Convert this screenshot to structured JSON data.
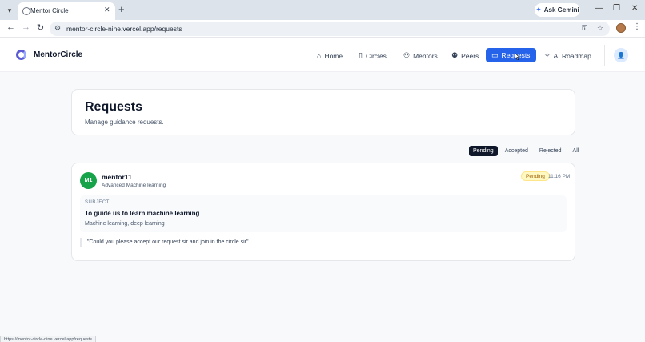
{
  "browser": {
    "tab_title": "Mentor Circle",
    "tab_close": "✕",
    "new_tab": "+",
    "ask_gemini": "Ask Gemini",
    "url": "mentor-circle-nine.vercel.app/requests",
    "status_url": "https://mentor-circle-nine.vercel.app/requests"
  },
  "header": {
    "brand": "MentorCircle",
    "nav": [
      {
        "label": "Home",
        "icon": "home-icon"
      },
      {
        "label": "Circles",
        "icon": "book-icon"
      },
      {
        "label": "Mentors",
        "icon": "user-check-icon"
      },
      {
        "label": "Peers",
        "icon": "users-icon"
      },
      {
        "label": "Requests",
        "icon": "message-icon",
        "active": true
      },
      {
        "label": "AI Roadmap",
        "icon": "sparkles-icon"
      }
    ]
  },
  "page": {
    "title": "Requests",
    "subtitle": "Manage guidance requests."
  },
  "filters": [
    "Pending",
    "Accepted",
    "Rejected",
    "All"
  ],
  "active_filter": "Pending",
  "requests": [
    {
      "avatar_initials": "M1",
      "name": "mentor11",
      "topic": "Advanced Machine learning",
      "status": "Pending",
      "time": "11:16 PM",
      "subject_label": "SUBJECT",
      "subject": "To guide us to learn machine learning",
      "tags": "Machine learning, deep learning",
      "message": "\"Could you please accept our request sir and join in the circle sir\""
    }
  ],
  "colors": {
    "accent": "#2563eb",
    "avatar": "#16a34a",
    "pending_badge_bg": "#fef9c3",
    "pending_badge_text": "#a16207"
  }
}
